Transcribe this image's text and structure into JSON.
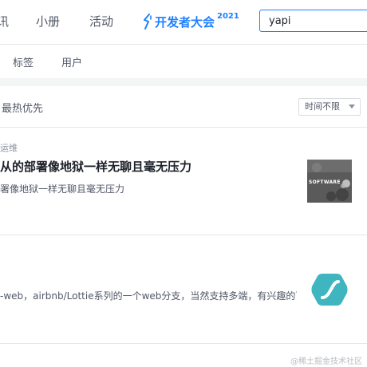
{
  "nav": {
    "items": [
      "讯",
      "小册",
      "活动"
    ],
    "event": {
      "text": "开发者大会",
      "year": "2021"
    }
  },
  "search": {
    "value": "yapi"
  },
  "subnav": {
    "items": [
      "标签",
      "用户"
    ]
  },
  "list": {
    "sort_label": "最热优先",
    "time_filter": "时间不限",
    "articles": [
      {
        "tag": "运维",
        "title": "从的部署像地狱一样无聊且毫无压力",
        "abstract": "署像地狱一样无聊且毫无压力",
        "thumb_text": "SOFTWARE"
      },
      {
        "tag": "",
        "title": "",
        "abstract": "-web，airbnb/Lottie系列的一个web分支，当然支持多端，有兴趣的可"
      }
    ]
  },
  "watermark": "@稀土掘金技术社区",
  "colors": {
    "accent": "#1e80ff",
    "lottie_teal": "#3fb5c0"
  }
}
